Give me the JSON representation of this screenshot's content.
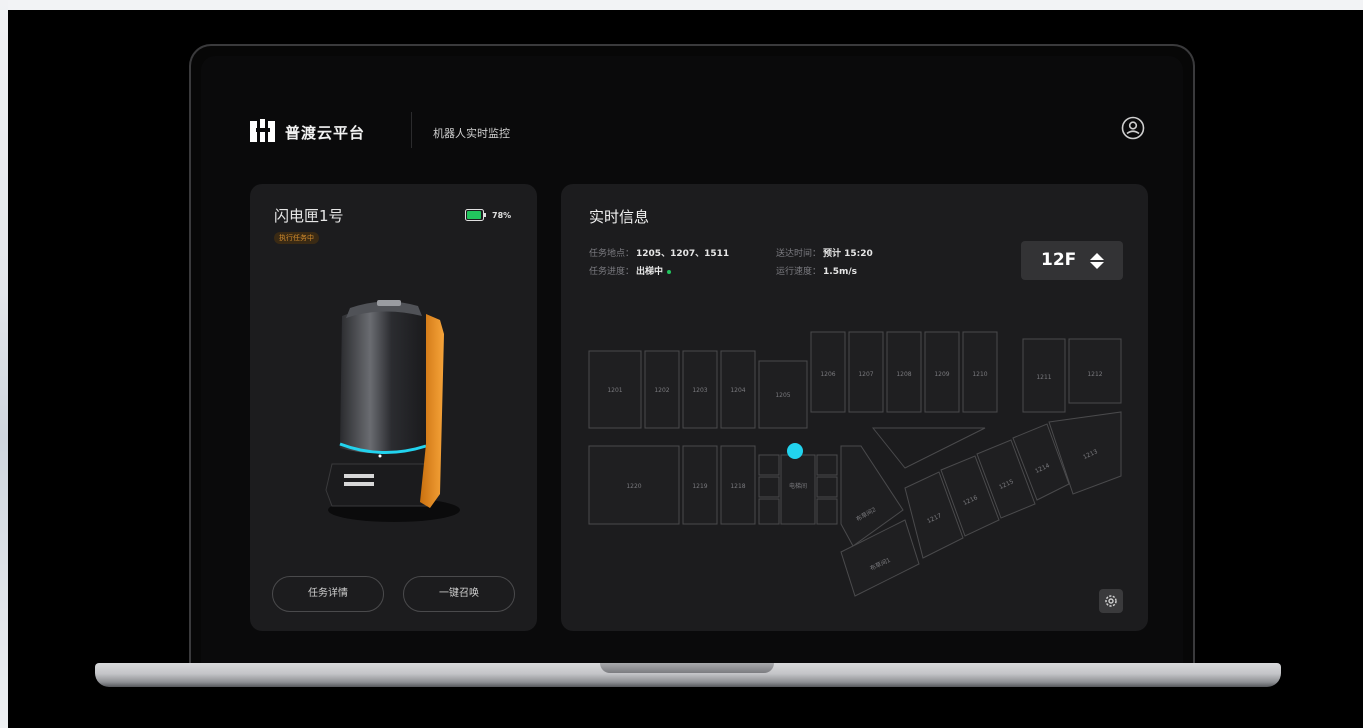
{
  "header": {
    "brand": "普渡云平台",
    "subtitle": "机器人实时监控",
    "logo_icon": "brand-logo-icon",
    "user_icon": "user-icon"
  },
  "robot": {
    "name": "闪电匣1号",
    "status": "执行任务中",
    "battery_text": "78%",
    "battery_level": 0.78,
    "battery_color": "#22c55e",
    "buttons": {
      "detail": "任务详情",
      "summon": "一键召唤"
    }
  },
  "info": {
    "title": "实时信息",
    "task_location_label": "任务地点：",
    "task_location_value": "1205、1207、1511",
    "task_progress_label": "任务进度：",
    "task_progress_value": "出梯中",
    "delivery_time_label": "送达时间：",
    "delivery_time_value": "预计 15:20",
    "speed_label": "运行速度：",
    "speed_value": "1.5m/s",
    "floor": "12F"
  },
  "map": {
    "rooms": {
      "r1201": "1201",
      "r1202": "1202",
      "r1203": "1203",
      "r1204": "1204",
      "r1205": "1205",
      "r1206": "1206",
      "r1207": "1207",
      "r1208": "1208",
      "r1209": "1209",
      "r1210": "1210",
      "r1211": "1211",
      "r1212": "1212",
      "r1213": "1213",
      "r1214": "1214",
      "r1215": "1215",
      "r1216": "1216",
      "r1217": "1217",
      "r1218": "1218",
      "r1219": "1219",
      "r1220": "1220",
      "elevator": "电梯间",
      "linen2": "布草间2",
      "linen1": "布草间1"
    },
    "robot_marker_color": "#22d3ee"
  },
  "colors": {
    "card_bg": "#1c1c1e",
    "accent_orange": "#f29a1f"
  }
}
